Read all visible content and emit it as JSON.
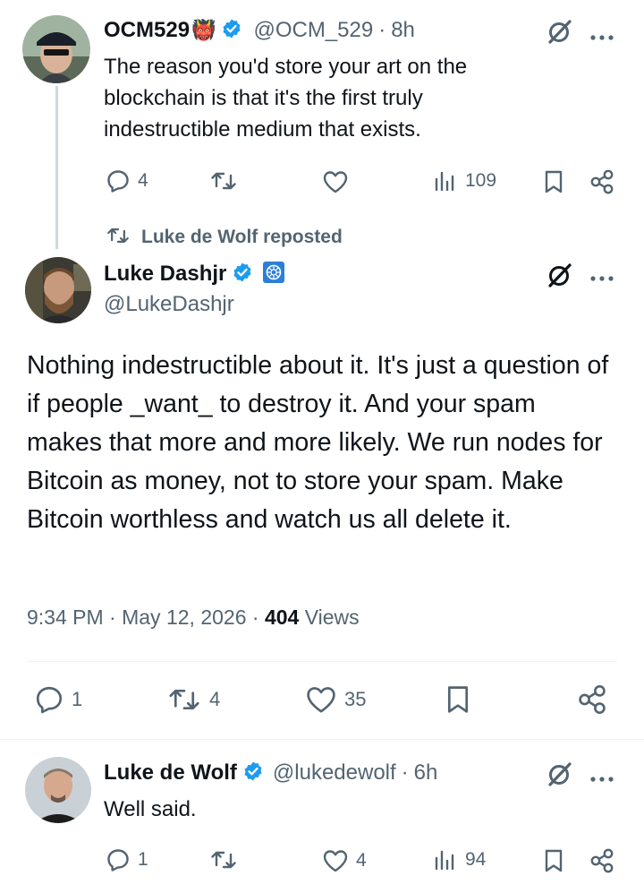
{
  "tweet1": {
    "name": "OCM529",
    "name_emoji": "👹",
    "handle": "@OCM_529",
    "separator": "·",
    "time": "8h",
    "text": "The reason you'd store your art on the blockchain is that it's the first truly indestructible medium that exists.",
    "replies": "4",
    "reposts": "",
    "likes": "",
    "views": "109"
  },
  "repost_label": "Luke de Wolf reposted",
  "main_tweet": {
    "name": "Luke Dashjr",
    "handle": "@LukeDashjr",
    "text": "Nothing indestructible about it. It's just a question of if people _want_ to destroy it. And your spam makes that more and more likely. We run nodes for Bitcoin as money, not to store your spam. Make Bitcoin worthless and watch us all delete it.",
    "time": "9:34 PM",
    "sep": "·",
    "date": "May 12, 2026",
    "views_count": "404",
    "views_label": "Views",
    "replies": "1",
    "reposts": "4",
    "likes": "35"
  },
  "tweet3": {
    "name": "Luke de Wolf",
    "handle": "@lukedewolf",
    "separator": "·",
    "time": "6h",
    "text": "Well said.",
    "replies": "1",
    "likes": "4",
    "views": "94"
  },
  "icons": {
    "verified": "verified-badge-icon",
    "grok": "grok-icon",
    "more": "more-dots-icon",
    "reply": "reply-icon",
    "repost": "repost-icon",
    "like": "like-icon",
    "views": "views-icon",
    "bookmark": "bookmark-icon",
    "share": "share-icon",
    "affiliate": "affiliate-badge-icon"
  },
  "colors": {
    "verified": "#1d9bf0",
    "text": "#0f1419",
    "secondary": "#536471",
    "affiliate": "#2b7fd8"
  }
}
